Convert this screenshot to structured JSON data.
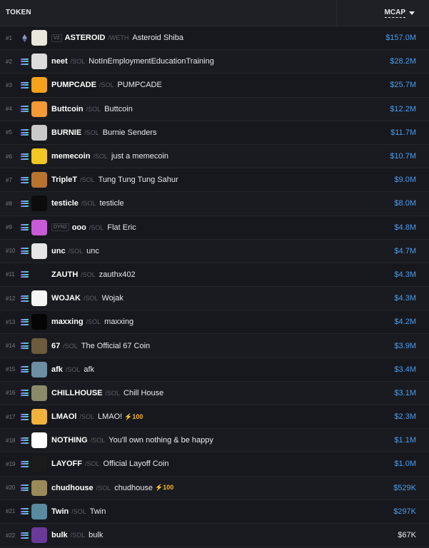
{
  "header": {
    "token_label": "TOKEN",
    "mcap_label": "MCAP"
  },
  "colors": {
    "mcap_blue": "#4a9ef0",
    "boost_yellow": "#f5b72a"
  },
  "rows": [
    {
      "rank": "#1",
      "chain": "eth",
      "badge": "V2",
      "symbol": "ASTEROID",
      "pair": "/WETH",
      "name": "Asteroid Shiba",
      "boost": "",
      "mcap": "$157.0M",
      "avatar_bg": "#e9e6dc",
      "avatar_icon": "shiba-avatar-icon"
    },
    {
      "rank": "#2",
      "chain": "sol",
      "badge": "",
      "symbol": "neet",
      "pair": "/SOL",
      "name": "NotInEmploymentEducationTraining",
      "boost": "",
      "mcap": "$28.2M",
      "avatar_bg": "#dcdcdc",
      "avatar_icon": "neet-avatar-icon"
    },
    {
      "rank": "#3",
      "chain": "sol",
      "badge": "",
      "symbol": "PUMPCADE",
      "pair": "/SOL",
      "name": "PUMPCADE",
      "boost": "",
      "mcap": "$25.7M",
      "avatar_bg": "#f5a31a",
      "avatar_icon": "pumpcade-avatar-icon"
    },
    {
      "rank": "#4",
      "chain": "sol",
      "badge": "",
      "symbol": "Buttcoin",
      "pair": "/SOL",
      "name": "Buttcoin",
      "boost": "",
      "mcap": "$12.2M",
      "avatar_bg": "#f39a36",
      "avatar_icon": "buttcoin-avatar-icon"
    },
    {
      "rank": "#5",
      "chain": "sol",
      "badge": "",
      "symbol": "BURNIE",
      "pair": "/SOL",
      "name": "Burnie Senders",
      "boost": "",
      "mcap": "$11.7M",
      "avatar_bg": "#c9c9c9",
      "avatar_icon": "burnie-avatar-icon"
    },
    {
      "rank": "#6",
      "chain": "sol",
      "badge": "",
      "symbol": "memecoin",
      "pair": "/SOL",
      "name": "just a memecoin",
      "boost": "",
      "mcap": "$10.7M",
      "avatar_bg": "#f2c623",
      "avatar_icon": "memecoin-avatar-icon"
    },
    {
      "rank": "#7",
      "chain": "sol",
      "badge": "",
      "symbol": "TripleT",
      "pair": "/SOL",
      "name": "Tung Tung Tung Sahur",
      "boost": "",
      "mcap": "$9.0M",
      "avatar_bg": "#b8742f",
      "avatar_icon": "triplet-avatar-icon"
    },
    {
      "rank": "#8",
      "chain": "sol",
      "badge": "",
      "symbol": "testicle",
      "pair": "/SOL",
      "name": "testicle",
      "boost": "",
      "mcap": "$8.0M",
      "avatar_bg": "#0c0c0c",
      "avatar_icon": "testicle-avatar-icon"
    },
    {
      "rank": "#9",
      "chain": "sol",
      "badge": "DYN2",
      "symbol": "ooo",
      "pair": "/SOL",
      "name": "Flat Eric",
      "boost": "",
      "mcap": "$4.8M",
      "avatar_bg": "#c85bd6",
      "avatar_icon": "flat-eric-avatar-icon"
    },
    {
      "rank": "#10",
      "chain": "sol",
      "badge": "",
      "symbol": "unc",
      "pair": "/SOL",
      "name": "unc",
      "boost": "",
      "mcap": "$4.7M",
      "avatar_bg": "#e6e6e6",
      "avatar_icon": "unc-avatar-icon"
    },
    {
      "rank": "#11",
      "chain": "sol",
      "badge": "",
      "symbol": "ZAUTH",
      "pair": "/SOL",
      "name": "zauthx402",
      "boost": "",
      "mcap": "$4.3M",
      "avatar_bg": "#17181d",
      "avatar_icon": "zauth-avatar-icon"
    },
    {
      "rank": "#12",
      "chain": "sol",
      "badge": "",
      "symbol": "WOJAK",
      "pair": "/SOL",
      "name": "Wojak",
      "boost": "",
      "mcap": "$4.3M",
      "avatar_bg": "#f4f4f4",
      "avatar_icon": "wojak-avatar-icon"
    },
    {
      "rank": "#13",
      "chain": "sol",
      "badge": "",
      "symbol": "maxxing",
      "pair": "/SOL",
      "name": "maxxing",
      "boost": "",
      "mcap": "$4.2M",
      "avatar_bg": "#050505",
      "avatar_icon": "maxxing-avatar-icon"
    },
    {
      "rank": "#14",
      "chain": "sol",
      "badge": "",
      "symbol": "67",
      "pair": "/SOL",
      "name": "The Official 67 Coin",
      "boost": "",
      "mcap": "$3.9M",
      "avatar_bg": "#6e5a3c",
      "avatar_icon": "sixty-seven-avatar-icon"
    },
    {
      "rank": "#15",
      "chain": "sol",
      "badge": "",
      "symbol": "afk",
      "pair": "/SOL",
      "name": "afk",
      "boost": "",
      "mcap": "$3.4M",
      "avatar_bg": "#6c8fa3",
      "avatar_icon": "afk-avatar-icon"
    },
    {
      "rank": "#16",
      "chain": "sol",
      "badge": "",
      "symbol": "CHILLHOUSE",
      "pair": "/SOL",
      "name": "Chill House",
      "boost": "",
      "mcap": "$3.1M",
      "avatar_bg": "#8a8a6a",
      "avatar_icon": "chillhouse-avatar-icon"
    },
    {
      "rank": "#17",
      "chain": "sol",
      "badge": "",
      "symbol": "LMAOl",
      "pair": "/SOL",
      "name": "LMAO!",
      "boost": "100",
      "mcap": "$2.3M",
      "avatar_bg": "#f0b23c",
      "avatar_icon": "lmao-avatar-icon"
    },
    {
      "rank": "#18",
      "chain": "sol",
      "badge": "",
      "symbol": "NOTHING",
      "pair": "/SOL",
      "name": "You'll own nothing & be happy",
      "boost": "",
      "mcap": "$1.1M",
      "avatar_bg": "#ffffff",
      "avatar_icon": "nothing-avatar-icon"
    },
    {
      "rank": "#19",
      "chain": "sol",
      "badge": "",
      "symbol": "LAYOFF",
      "pair": "/SOL",
      "name": "Official Layoff Coin",
      "boost": "",
      "mcap": "$1.0M",
      "avatar_bg": "#1b1b1b",
      "avatar_icon": "layoff-avatar-icon"
    },
    {
      "rank": "#20",
      "chain": "sol",
      "badge": "",
      "symbol": "chudhouse",
      "pair": "/SOL",
      "name": "chudhouse",
      "boost": "100",
      "mcap": "$529K",
      "avatar_bg": "#9a8a5a",
      "avatar_icon": "chudhouse-avatar-icon"
    },
    {
      "rank": "#21",
      "chain": "sol",
      "badge": "",
      "symbol": "Twin",
      "pair": "/SOL",
      "name": "Twin",
      "boost": "",
      "mcap": "$297K",
      "avatar_bg": "#5a8aa0",
      "avatar_icon": "twin-avatar-icon"
    },
    {
      "rank": "#22",
      "chain": "sol",
      "badge": "",
      "symbol": "bulk",
      "pair": "/SOL",
      "name": "bulk",
      "boost": "",
      "mcap": "$67K",
      "mcap_white": true,
      "avatar_bg": "#6a3a9a",
      "avatar_icon": "bulk-avatar-icon"
    }
  ]
}
